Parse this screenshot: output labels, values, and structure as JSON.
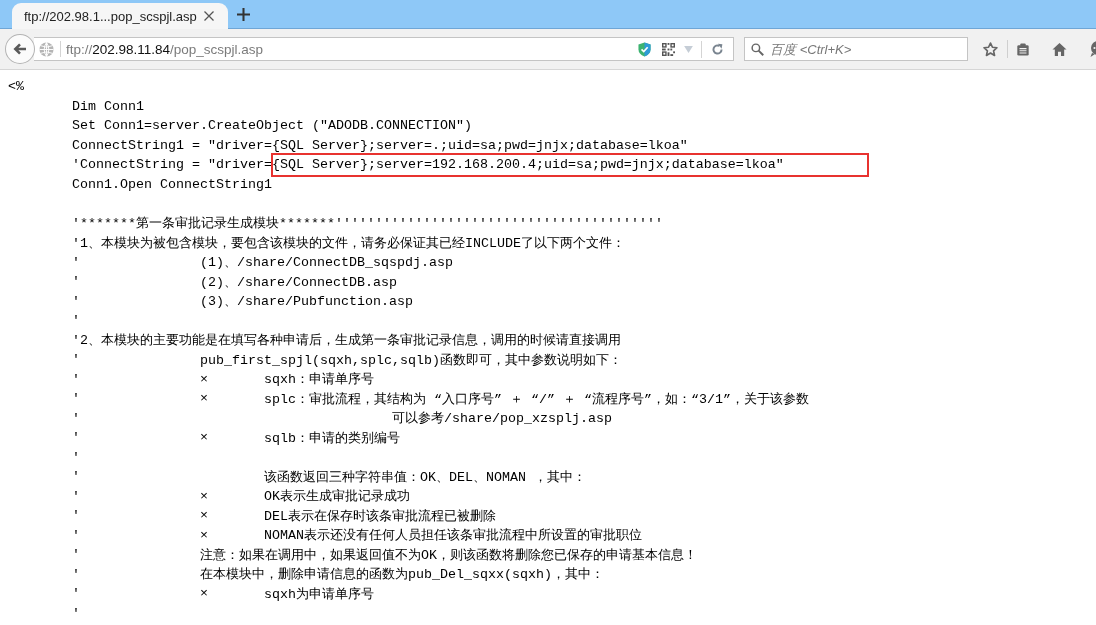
{
  "browser": {
    "tabs": [
      {
        "title": "ftp://202.98.1...pop_scspjl.asp",
        "selected": true
      }
    ],
    "address_bar": {
      "url": "ftp://**202.98.11.84**/pop_scspjl.asp"
    },
    "search": {
      "placeholder": "百度 <Ctrl+K>"
    }
  },
  "code_blocks": [
    {
      "lines": [
        {
          "kind": "tag",
          "text": "<%",
          "highlighted": false
        },
        {
          "kind": "code",
          "text": "Dim Conn1",
          "highlighted": false
        },
        {
          "kind": "code",
          "text": "Set Conn1=server.CreateObject (\"ADODB.CONNECTION\")",
          "highlighted": false
        },
        {
          "kind": "code",
          "text": "ConnectString1 = \"driver={SQL Server};server=.;uid=sa;pwd=jnjx;database=lkoa\"",
          "highlighted": false
        },
        {
          "kind": "code",
          "text": "'ConnectString = \"driver={SQL Server};server=192.168.200.4;uid=sa;pwd=jnjx;database=lkoa\"",
          "highlighted": true
        },
        {
          "kind": "code",
          "text": "Conn1.Open ConnectString1",
          "highlighted": false
        }
      ]
    },
    {
      "lines": [
        {
          "kind": "comment",
          "text": "'*******第一条审批记录生成模块*******'''''''''''''''''''''''''''''''''''''''''",
          "highlighted": false
        },
        {
          "kind": "comment",
          "text": "'1、本模块为被包含模块，要包含该模块的文件，请务必保证其已经INCLUDE了以下两个文件：",
          "highlighted": false
        },
        {
          "kind": "comment_indented",
          "comment_mark": "'",
          "text": "(1)、/share/ConnectDB_sqspdj.asp",
          "highlighted": false
        },
        {
          "kind": "comment_indented",
          "comment_mark": "'",
          "text": "(2)、/share/ConnectDB.asp",
          "highlighted": false
        },
        {
          "kind": "comment_indented",
          "comment_mark": "'",
          "text": "(3)、/share/Pubfunction.asp",
          "highlighted": false
        },
        {
          "kind": "comment_blank",
          "comment_mark": "'",
          "highlighted": false
        },
        {
          "kind": "comment",
          "text": "'2、本模块的主要功能是在填写各种申请后，生成第一条审批记录信息，调用的时候请直接调用",
          "highlighted": false
        },
        {
          "kind": "comment_indented",
          "comment_mark": "'",
          "text": "pub_first_spjl(sqxh,splc,sqlb)函数即可，其中参数说明如下：",
          "highlighted": false
        },
        {
          "kind": "comment_bullet",
          "comment_mark": "'",
          "bullet": "×",
          "text": "sqxh：申请单序号",
          "highlighted": false
        },
        {
          "kind": "comment_bullet",
          "comment_mark": "'",
          "bullet": "×",
          "text": "splc：审批流程，其结构为 “入口序号” ＋ “/” ＋ “流程序号”，如：“3/1”，关于该参数",
          "highlighted": false
        },
        {
          "kind": "comment_wrap",
          "comment_mark": "'",
          "text": "可以参考/share/pop_xzsplj.asp",
          "highlighted": false
        },
        {
          "kind": "comment_bullet",
          "comment_mark": "'",
          "bullet": "×",
          "text": "sqlb：申请的类别编号",
          "highlighted": false
        },
        {
          "kind": "comment_blank",
          "comment_mark": "'",
          "highlighted": false
        },
        {
          "kind": "comment_sub",
          "comment_mark": "'",
          "text": "该函数返回三种字符串值：OK、DEL、NOMAN ，其中：",
          "highlighted": false
        },
        {
          "kind": "comment_bullet",
          "comment_mark": "'",
          "bullet": "×",
          "text": "OK表示生成审批记录成功",
          "highlighted": false
        },
        {
          "kind": "comment_bullet",
          "comment_mark": "'",
          "bullet": "×",
          "text": "DEL表示在保存时该条审批流程已被删除",
          "highlighted": false
        },
        {
          "kind": "comment_bullet",
          "comment_mark": "'",
          "bullet": "×",
          "text": "NOMAN表示还没有任何人员担任该条审批流程中所设置的审批职位",
          "highlighted": false
        },
        {
          "kind": "comment_indented",
          "comment_mark": "'",
          "text": "注意：如果在调用中，如果返回值不为OK，则该函数将删除您已保存的申请基本信息！",
          "highlighted": false
        },
        {
          "kind": "comment_indented",
          "comment_mark": "'",
          "text": "在本模块中，删除申请信息的函数为pub_Del_sqxx(sqxh)，其中：",
          "highlighted": false
        },
        {
          "kind": "comment_bullet",
          "comment_mark": "'",
          "bullet": "×",
          "text": "sqxh为申请单序号",
          "highlighted": false
        },
        {
          "kind": "comment_blank",
          "comment_mark": "'",
          "highlighted": false
        }
      ]
    }
  ]
}
